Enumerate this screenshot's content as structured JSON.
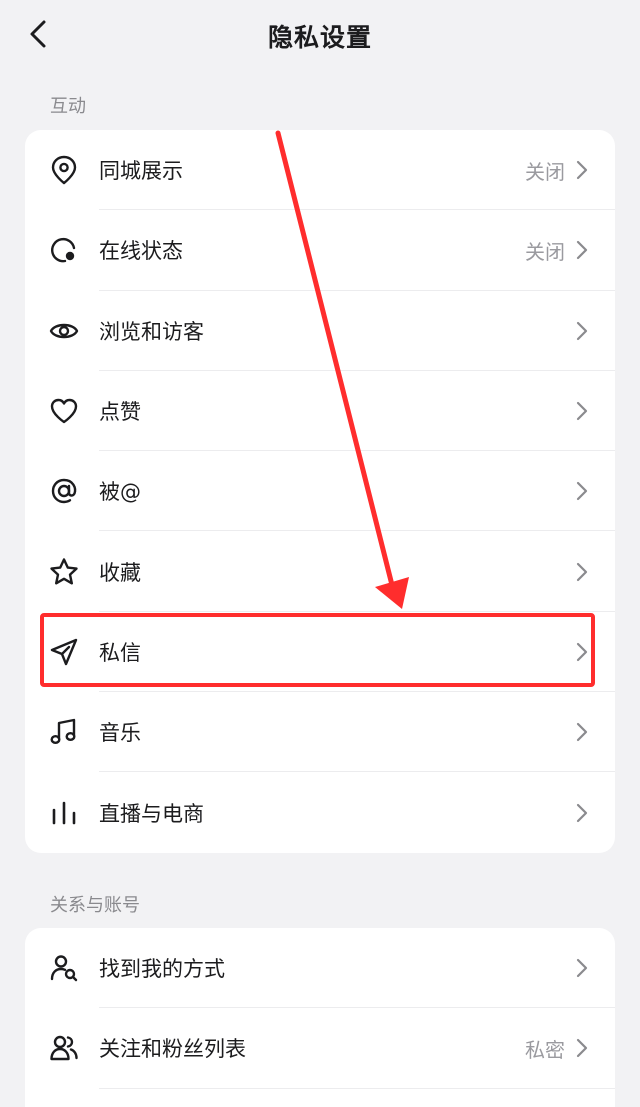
{
  "header": {
    "title": "隐私设置"
  },
  "sections": [
    {
      "title": "互动",
      "items": [
        {
          "label": "同城展示",
          "value": "关闭",
          "icon": "location-pin-icon"
        },
        {
          "label": "在线状态",
          "value": "关闭",
          "icon": "online-status-icon"
        },
        {
          "label": "浏览和访客",
          "value": "",
          "icon": "eye-icon"
        },
        {
          "label": "点赞",
          "value": "",
          "icon": "heart-icon"
        },
        {
          "label": "被@",
          "value": "",
          "icon": "at-icon"
        },
        {
          "label": "收藏",
          "value": "",
          "icon": "star-icon"
        },
        {
          "label": "私信",
          "value": "",
          "icon": "paper-plane-icon"
        },
        {
          "label": "音乐",
          "value": "",
          "icon": "music-note-icon"
        },
        {
          "label": "直播与电商",
          "value": "",
          "icon": "bar-chart-icon"
        }
      ]
    },
    {
      "title": "关系与账号",
      "items": [
        {
          "label": "找到我的方式",
          "value": "",
          "icon": "find-user-icon"
        },
        {
          "label": "关注和粉丝列表",
          "value": "私密",
          "icon": "users-icon"
        }
      ]
    }
  ],
  "colors": {
    "background": "#f2f2f4",
    "card": "#ffffff",
    "highlight": "#ff2d2d",
    "secondary_text": "#9a9a9f"
  }
}
